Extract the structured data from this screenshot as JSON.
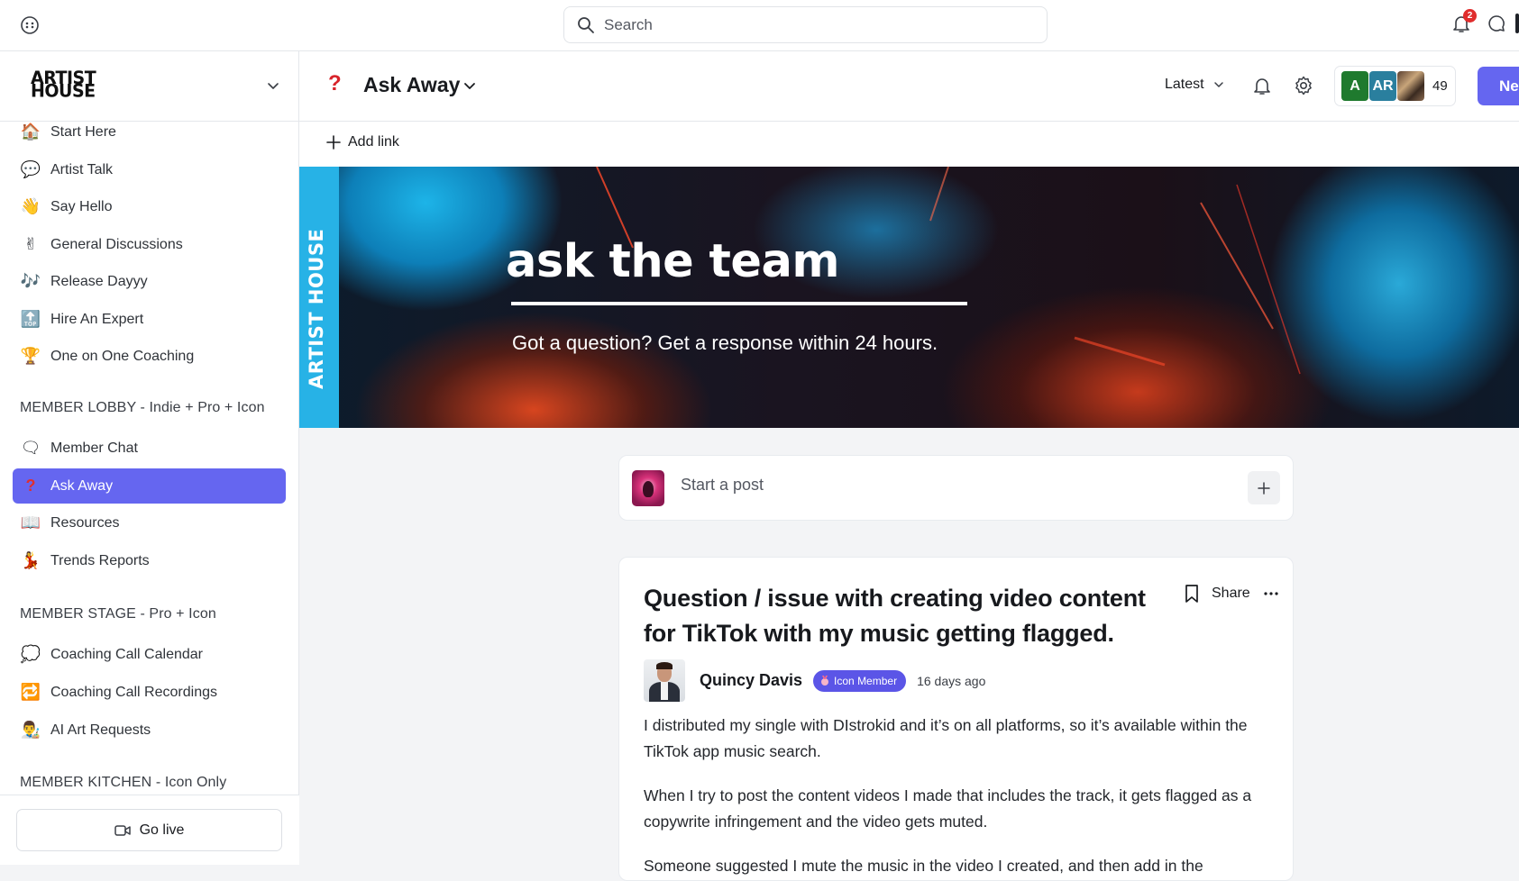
{
  "topbar": {
    "search_placeholder": "Search",
    "notifications_count": "2"
  },
  "brand": {
    "logo_line1": "ARTIST",
    "logo_line2": "HOUSE"
  },
  "sidebar": {
    "items": [
      {
        "label": "Start Here",
        "icon": "house-icon"
      },
      {
        "label": "Artist Talk",
        "icon": "speech-bubble-icon"
      },
      {
        "label": "Say Hello",
        "icon": "waving-hand-icon"
      },
      {
        "label": "General Discussions",
        "icon": "victory-hand-icon"
      },
      {
        "label": "Release Dayyy",
        "icon": "music-notes-icon"
      },
      {
        "label": "Hire An Expert",
        "icon": "top-arrow-icon"
      },
      {
        "label": "One on One Coaching",
        "icon": "trophy-icon"
      }
    ],
    "section_lobby": "MEMBER LOBBY - Indie + Pro + Icon",
    "lobby_items": [
      {
        "label": "Member Chat",
        "icon": "thought-bubble-icon"
      },
      {
        "label": "Ask Away",
        "icon": "question-mark-icon",
        "active": true
      },
      {
        "label": "Resources",
        "icon": "open-book-icon"
      },
      {
        "label": "Trends Reports",
        "icon": "dancer-icon"
      }
    ],
    "section_stage": "MEMBER STAGE - Pro + Icon",
    "stage_items": [
      {
        "label": "Coaching Call Calendar",
        "icon": "speech-balloon-icon"
      },
      {
        "label": "Coaching Call Recordings",
        "icon": "repeat-icon"
      },
      {
        "label": "AI Art Requests",
        "icon": "artist-icon"
      }
    ],
    "section_kitchen": "MEMBER KITCHEN - Icon Only",
    "go_live": "Go live"
  },
  "header": {
    "space_title": "Ask Away",
    "sort_label": "Latest",
    "members": {
      "avatar1": "A",
      "avatar2": "AR",
      "count": "49"
    },
    "new_button": "Ne"
  },
  "linkbar": {
    "add_link": "Add link"
  },
  "banner": {
    "vertical_text": "ARTIST HOUSE",
    "title": "ask the team",
    "subtitle": "Got a question? Get a response within 24 hours."
  },
  "composer": {
    "placeholder": "Start a post"
  },
  "post": {
    "title": "Question / issue with creating video content for TikTok with my music getting flagged.",
    "share_label": "Share",
    "author_name": "Quincy Davis",
    "badge": "Icon Member",
    "time_ago": "16 days ago",
    "paragraphs": [
      "I distributed my single with DIstrokid and it’s on all platforms, so it’s available within the TikTok app music search.",
      "When I try to post the content videos I made that includes the track, it gets flagged as a copywrite infringement and the video gets muted.",
      "Someone suggested I mute the music in the video I created, and then add in the"
    ]
  },
  "colors": {
    "accent": "#6566f0",
    "badge": "#5b55e7",
    "banner_blue": "#27b2e6"
  }
}
